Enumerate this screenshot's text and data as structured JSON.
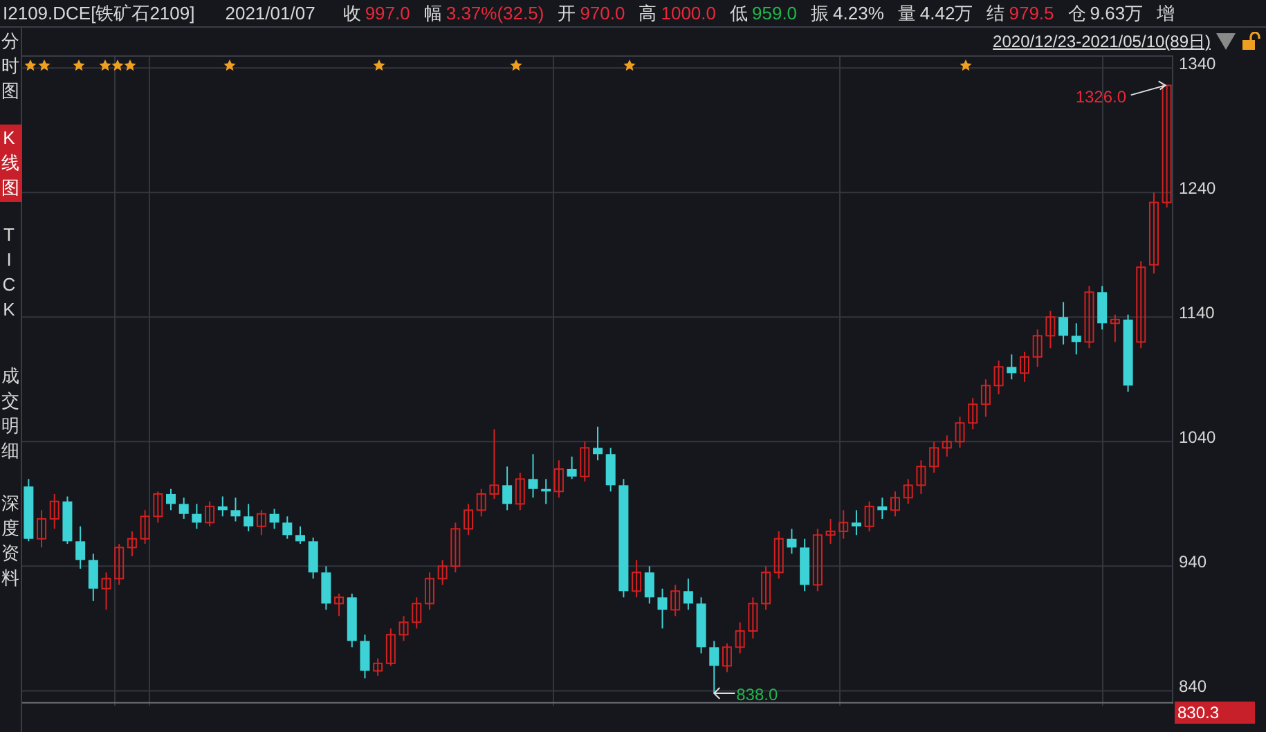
{
  "quote_bar": {
    "symbol": "I2109.DCE[铁矿石2109]",
    "date": "2021/01/07",
    "fields": [
      {
        "label": "收",
        "value": "997.0",
        "color": "#e8293a"
      },
      {
        "label": "幅",
        "value": "3.37%(32.5)",
        "color": "#e8293a"
      },
      {
        "label": "开",
        "value": "970.0",
        "color": "#e8293a"
      },
      {
        "label": "高",
        "value": "1000.0",
        "color": "#e8293a"
      },
      {
        "label": "低",
        "value": "959.0",
        "color": "#22b54a"
      },
      {
        "label": "振",
        "value": "4.23%",
        "color": "#d8d8d8"
      },
      {
        "label": "量",
        "value": "4.42万",
        "color": "#d8d8d8"
      },
      {
        "label": "结",
        "value": "979.5",
        "color": "#e8293a"
      },
      {
        "label": "仓",
        "value": "9.63万",
        "color": "#d8d8d8"
      },
      {
        "label": "增"
      }
    ]
  },
  "sidebar": {
    "tabs": [
      {
        "label": "分时图",
        "selected": false
      },
      {
        "label": "K线图",
        "selected": true
      },
      {
        "label": "TICK",
        "selected": false
      },
      {
        "label": "成交明细",
        "selected": false
      },
      {
        "label": "深度资料",
        "selected": false
      }
    ]
  },
  "range": {
    "label": "2020/12/23-2021/05/10(89日)"
  },
  "chart": {
    "markers": {
      "high": "1326.0",
      "low": "838.0"
    },
    "current_price": "830.3",
    "chart_data": {
      "type": "candlestick",
      "grid": true,
      "ylim": [
        828,
        1349
      ],
      "yticks": [
        1340,
        1240,
        1140,
        1040,
        940,
        840
      ],
      "ohlc": [
        [
          1004,
          1010,
          960,
          962
        ],
        [
          962,
          985,
          955,
          978
        ],
        [
          978,
          998,
          970,
          992
        ],
        [
          992,
          996,
          958,
          960
        ],
        [
          960,
          972,
          938,
          945
        ],
        [
          945,
          950,
          912,
          922
        ],
        [
          922,
          935,
          905,
          930
        ],
        [
          930,
          958,
          925,
          955
        ],
        [
          955,
          968,
          948,
          962
        ],
        [
          962,
          985,
          958,
          980
        ],
        [
          980,
          1000,
          975,
          998
        ],
        [
          998,
          1002,
          985,
          990
        ],
        [
          990,
          995,
          978,
          982
        ],
        [
          982,
          990,
          970,
          975
        ],
        [
          975,
          992,
          972,
          988
        ],
        [
          988,
          996,
          980,
          985
        ],
        [
          985,
          995,
          976,
          980
        ],
        [
          980,
          990,
          968,
          972
        ],
        [
          972,
          985,
          965,
          982
        ],
        [
          982,
          986,
          970,
          975
        ],
        [
          975,
          980,
          962,
          965
        ],
        [
          965,
          972,
          958,
          960
        ],
        [
          960,
          963,
          930,
          935
        ],
        [
          935,
          940,
          905,
          910
        ],
        [
          910,
          918,
          900,
          915
        ],
        [
          915,
          918,
          875,
          880
        ],
        [
          880,
          885,
          850,
          856
        ],
        [
          856,
          866,
          852,
          862
        ],
        [
          862,
          890,
          860,
          885
        ],
        [
          885,
          900,
          880,
          895
        ],
        [
          895,
          915,
          890,
          910
        ],
        [
          910,
          935,
          905,
          930
        ],
        [
          930,
          945,
          925,
          940
        ],
        [
          940,
          975,
          935,
          970
        ],
        [
          970,
          990,
          965,
          985
        ],
        [
          985,
          1002,
          980,
          998
        ],
        [
          998,
          1050,
          994,
          1005
        ],
        [
          1005,
          1020,
          985,
          990
        ],
        [
          990,
          1015,
          985,
          1010
        ],
        [
          1010,
          1030,
          995,
          1002
        ],
        [
          1002,
          1010,
          990,
          1000
        ],
        [
          1000,
          1025,
          995,
          1018
        ],
        [
          1018,
          1028,
          1010,
          1012
        ],
        [
          1012,
          1040,
          1008,
          1035
        ],
        [
          1035,
          1052,
          1025,
          1030
        ],
        [
          1030,
          1035,
          1000,
          1005
        ],
        [
          1005,
          1010,
          915,
          920
        ],
        [
          920,
          945,
          915,
          935
        ],
        [
          935,
          940,
          910,
          915
        ],
        [
          915,
          922,
          890,
          905
        ],
        [
          905,
          925,
          900,
          920
        ],
        [
          920,
          930,
          905,
          910
        ],
        [
          910,
          915,
          870,
          875
        ],
        [
          875,
          880,
          838,
          860
        ],
        [
          860,
          878,
          855,
          875
        ],
        [
          875,
          895,
          870,
          888
        ],
        [
          888,
          915,
          882,
          910
        ],
        [
          910,
          940,
          905,
          935
        ],
        [
          935,
          968,
          930,
          962
        ],
        [
          962,
          970,
          950,
          955
        ],
        [
          955,
          962,
          920,
          925
        ],
        [
          925,
          970,
          920,
          965
        ],
        [
          965,
          978,
          958,
          968
        ],
        [
          968,
          985,
          962,
          975
        ],
        [
          975,
          985,
          965,
          972
        ],
        [
          972,
          992,
          968,
          988
        ],
        [
          988,
          995,
          978,
          985
        ],
        [
          985,
          1000,
          980,
          995
        ],
        [
          995,
          1010,
          990,
          1005
        ],
        [
          1005,
          1025,
          998,
          1020
        ],
        [
          1020,
          1040,
          1015,
          1035
        ],
        [
          1035,
          1045,
          1028,
          1040
        ],
        [
          1040,
          1060,
          1035,
          1055
        ],
        [
          1055,
          1075,
          1050,
          1070
        ],
        [
          1070,
          1090,
          1060,
          1085
        ],
        [
          1085,
          1105,
          1078,
          1100
        ],
        [
          1100,
          1110,
          1090,
          1095
        ],
        [
          1095,
          1112,
          1088,
          1108
        ],
        [
          1108,
          1130,
          1100,
          1125
        ],
        [
          1125,
          1145,
          1115,
          1140
        ],
        [
          1140,
          1152,
          1118,
          1125
        ],
        [
          1125,
          1135,
          1110,
          1120
        ],
        [
          1120,
          1165,
          1115,
          1160
        ],
        [
          1160,
          1165,
          1130,
          1135
        ],
        [
          1135,
          1142,
          1120,
          1138
        ],
        [
          1138,
          1142,
          1080,
          1085
        ],
        [
          1120,
          1185,
          1115,
          1180
        ],
        [
          1182,
          1240,
          1175,
          1232
        ],
        [
          1232,
          1326,
          1228,
          1326
        ]
      ]
    }
  }
}
